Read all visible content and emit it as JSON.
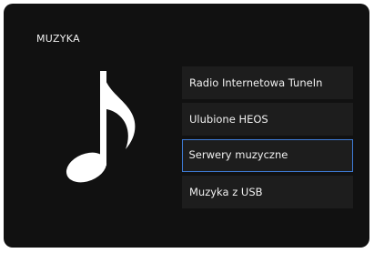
{
  "header": {
    "title": "MUZYKA"
  },
  "hero": {
    "icon": "music-note-icon",
    "color": "#ffffff"
  },
  "menu": {
    "selected_index": 2,
    "selected_border_color": "#3e7bd6",
    "items": [
      {
        "label": "Radio Internetowa TuneIn"
      },
      {
        "label": "Ulubione HEOS"
      },
      {
        "label": "Serwery muzyczne"
      },
      {
        "label": "Muzyka z USB"
      }
    ]
  }
}
